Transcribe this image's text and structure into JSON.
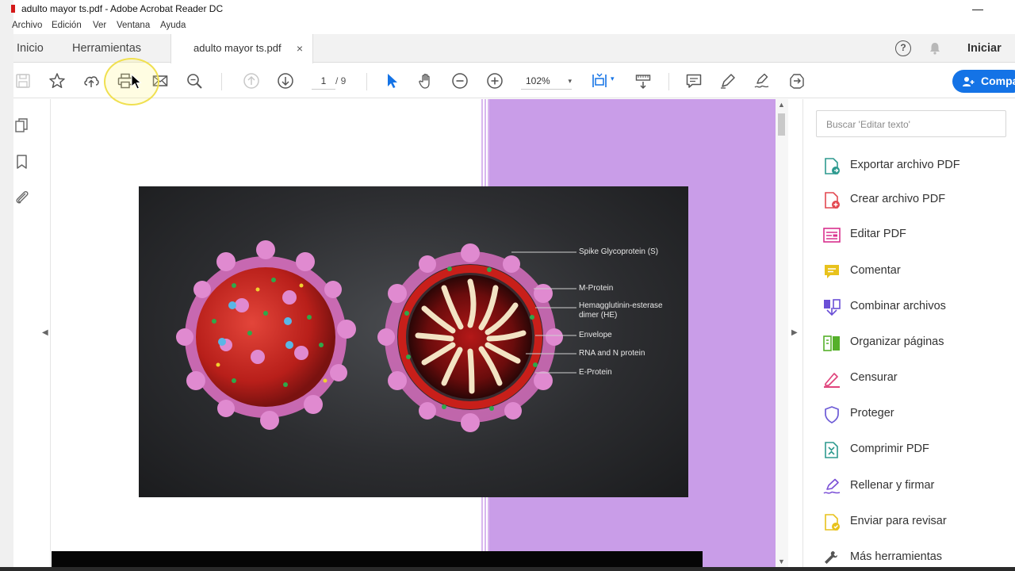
{
  "window": {
    "title": "adulto mayor ts.pdf - Adobe Acrobat Reader DC",
    "minimize_glyph": "—"
  },
  "menu": [
    "Archivo",
    "Edición",
    "Ver",
    "Ventana",
    "Ayuda"
  ],
  "tabs": {
    "home": "Inicio",
    "tools": "Herramientas",
    "document": "adulto mayor ts.pdf",
    "close_glyph": "×"
  },
  "header": {
    "help_glyph": "?",
    "signin": "Iniciar"
  },
  "toolbar": {
    "page_current": "1",
    "page_total": "/ 9",
    "zoom": "102%",
    "caret": "▾",
    "share_label": "Compartir",
    "icons": [
      "save-icon",
      "star-icon",
      "upload-icon",
      "print-icon",
      "email-icon",
      "search-zoom-icon",
      "prev-page-icon",
      "next-page-icon",
      "select-arrow-icon",
      "hand-icon",
      "zoom-out-icon",
      "zoom-in-icon",
      "fit-page-icon",
      "scroll-mode-icon",
      "comment-icon",
      "highlight-pen-icon",
      "sign-icon",
      "more-tools-icon"
    ]
  },
  "nav": {
    "left_arrow": "◀",
    "right_arrow": "▶",
    "scroll_up": "▲",
    "scroll_down": "▼"
  },
  "figure": {
    "labels": [
      "Spike Glycoprotein (S)",
      "M-Protein",
      "Hemagglutinin-esterase dimer (HE)",
      "Envelope",
      "RNA and N protein",
      "E-Protein"
    ]
  },
  "tools_pane": {
    "search_placeholder": "Buscar 'Editar texto'",
    "items": [
      {
        "label": "Exportar archivo PDF",
        "icon": "export-pdf-icon",
        "color": "#2e9a8f"
      },
      {
        "label": "Crear archivo PDF",
        "icon": "create-pdf-icon",
        "color": "#e34850"
      },
      {
        "label": "Editar PDF",
        "icon": "edit-pdf-icon",
        "color": "#d9308e"
      },
      {
        "label": "Comentar",
        "icon": "comment-tool-icon",
        "color": "#e8c21c"
      },
      {
        "label": "Combinar archivos",
        "icon": "combine-files-icon",
        "color": "#6a4fd6"
      },
      {
        "label": "Organizar páginas",
        "icon": "organize-pages-icon",
        "color": "#55b02a"
      },
      {
        "label": "Censurar",
        "icon": "redact-icon",
        "color": "#e0447c"
      },
      {
        "label": "Proteger",
        "icon": "protect-icon",
        "color": "#6c5ad6"
      },
      {
        "label": "Comprimir PDF",
        "icon": "compress-pdf-icon",
        "color": "#2e9a8f"
      },
      {
        "label": "Rellenar y firmar",
        "icon": "fill-sign-icon",
        "color": "#7a4fd6"
      },
      {
        "label": "Enviar para revisar",
        "icon": "send-review-icon",
        "color": "#e8c21c"
      },
      {
        "label": "Más herramientas",
        "icon": "more-tools-list-icon",
        "color": "#555555"
      }
    ]
  }
}
